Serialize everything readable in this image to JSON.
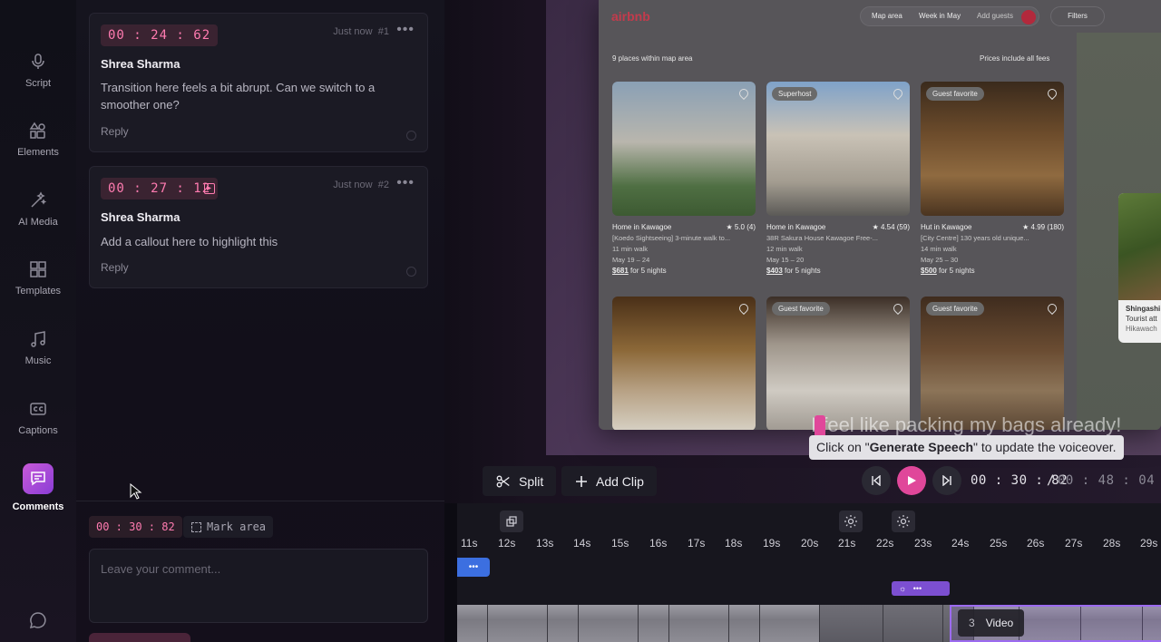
{
  "nav": {
    "items": [
      {
        "label": "Script",
        "icon": "microphone-icon"
      },
      {
        "label": "Elements",
        "icon": "shapes-icon"
      },
      {
        "label": "AI Media",
        "icon": "magic-wand-icon"
      },
      {
        "label": "Templates",
        "icon": "templates-grid-icon"
      },
      {
        "label": "Music",
        "icon": "music-note-icon"
      },
      {
        "label": "Captions",
        "icon": "closed-captions-icon"
      },
      {
        "label": "Comments",
        "icon": "comment-icon"
      }
    ],
    "active": "Comments"
  },
  "comments": [
    {
      "time": "00 : 24 : 62",
      "when": "Just now",
      "number": "#1",
      "author": "Shrea Sharma",
      "text": "Transition here feels a bit abrupt. Can we switch to a smoother one?",
      "reply": "Reply"
    },
    {
      "time": "00 : 27 : 12",
      "when": "Just now",
      "number": "#2",
      "author": "Shrea Sharma",
      "text": "Add a callout here to highlight this",
      "reply": "Reply"
    }
  ],
  "composer": {
    "time": "00 : 30 : 82",
    "mark_area": "Mark area",
    "placeholder": "Leave your comment..."
  },
  "preview": {
    "brand": "airbnb",
    "search": {
      "map_area": "Map area",
      "week": "Week in May",
      "guests": "Add guests"
    },
    "filters": "Filters",
    "count": "9 places within map area",
    "fees": "Prices include all fees",
    "listings": [
      {
        "badge": "",
        "title": "Home in Kawagoe",
        "rating": "★ 5.0 (4)",
        "line1": "[Koedo Sightseeing] 3-minute walk to...",
        "line2": "11 min walk",
        "dates": "May 19 – 24",
        "price": "$681",
        "price_suffix": "for 5 nights"
      },
      {
        "badge": "Superhost",
        "title": "Home in Kawagoe",
        "rating": "★ 4.54 (59)",
        "line1": "38R Sakura House Kawagoe Free-...",
        "line2": "12 min walk",
        "dates": "May 15 – 20",
        "price": "$403",
        "price_suffix": "for 5 nights"
      },
      {
        "badge": "Guest favorite",
        "title": "Hut in Kawagoe",
        "rating": "★ 4.99 (180)",
        "line1": "[City Centre] 130 years old unique...",
        "line2": "14 min walk",
        "dates": "May 25 – 30",
        "price": "$500",
        "price_suffix": "for 5 nights"
      },
      {
        "badge": "",
        "title": "",
        "rating": "",
        "line1": "",
        "line2": "",
        "dates": "",
        "price": "",
        "price_suffix": ""
      },
      {
        "badge": "Guest favorite",
        "title": "",
        "rating": "",
        "line1": "",
        "line2": "",
        "dates": "",
        "price": "",
        "price_suffix": ""
      },
      {
        "badge": "Guest favorite",
        "title": "",
        "rating": "",
        "line1": "",
        "line2": "",
        "dates": "",
        "price": "",
        "price_suffix": ""
      }
    ],
    "side_card": {
      "title": "Shingashi",
      "line1": "Tourist att",
      "line2": "Hikawach"
    },
    "subtitle": "I feel like packing my bags already!",
    "tooltip_prefix": "Click on \"",
    "tooltip_strong": "Generate Speech",
    "tooltip_suffix": "\" to update the voiceover."
  },
  "controls": {
    "split": "Split",
    "add_clip": "Add Clip",
    "current_time": "00 : 30 : 82",
    "separator": "/",
    "total_time": "00 : 48 : 04"
  },
  "timeline": {
    "ticks": [
      "11s",
      "12s",
      "13s",
      "14s",
      "15s",
      "16s",
      "17s",
      "18s",
      "19s",
      "20s",
      "21s",
      "22s",
      "23s",
      "24s",
      "25s",
      "26s",
      "27s",
      "28s",
      "29s"
    ],
    "clip_number": "3",
    "clip_label": "Video",
    "track_dots": "•••"
  },
  "colors": {
    "accent": "#e0479a",
    "timecode": "#ff7bb0",
    "selection": "#9c6bf0"
  }
}
